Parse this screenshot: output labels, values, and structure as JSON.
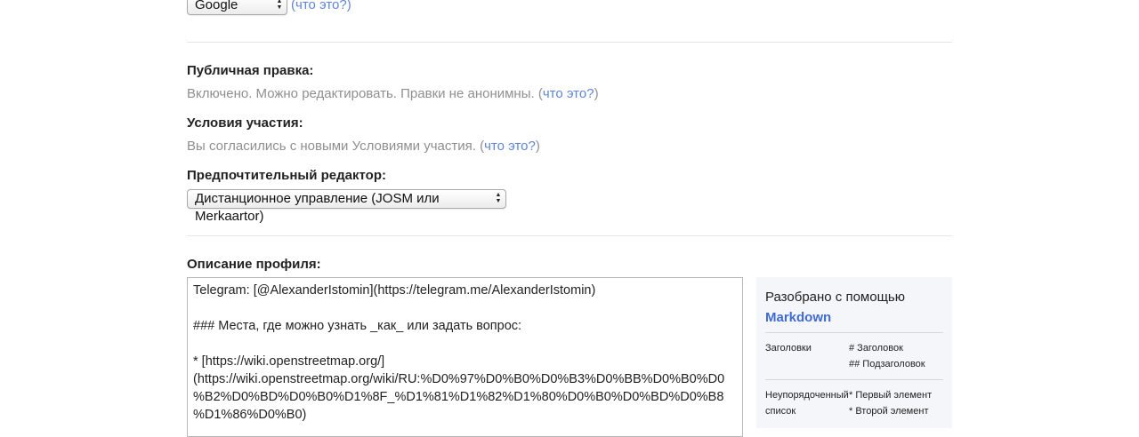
{
  "search_provider": {
    "selected": "Google",
    "what_link": "что это?"
  },
  "public_editing": {
    "label": "Публичная правка:",
    "text": "Включено. Можно редактировать. Правки не анонимны.",
    "what_link": "что это?"
  },
  "terms": {
    "label": "Условия участия:",
    "text": "Вы согласились с новыми Условиями участия.",
    "what_link": "что это?"
  },
  "preferred_editor": {
    "label": "Предпочтительный редактор:",
    "selected": "Дистанционное управление (JOSM или Merkaartor)"
  },
  "profile_description": {
    "label": "Описание профиля:",
    "lines": [
      "Telegram: [@AlexanderIstomin](https://telegram.me/AlexanderIstomin)",
      "",
      "### Места, где можно узнать _как_ или задать вопрос:",
      "",
      "* [https://wiki.openstreetmap.org/]",
      "(https://wiki.openstreetmap.org/wiki/RU:%D0%97%D0%B0%D0%B3%D0%BB%D0%B0%D0",
      "%B2%D0%BD%D0%B0%D1%8F_%D1%81%D1%82%D1%80%D0%B0%D0%BD%D0%B8",
      "%D1%86%D0%B0)"
    ]
  },
  "markdown_help": {
    "title": "Разобрано с помощью",
    "link": "Markdown",
    "rows": [
      {
        "key_line1": "Заголовки",
        "key_line2": "",
        "val_line1": "# Заголовок",
        "val_line2": "## Подзаголовок"
      },
      {
        "key_line1": "Неупорядоченный",
        "key_line2": "список",
        "val_line1": "* Первый элемент",
        "val_line2": "* Второй элемент"
      }
    ]
  }
}
